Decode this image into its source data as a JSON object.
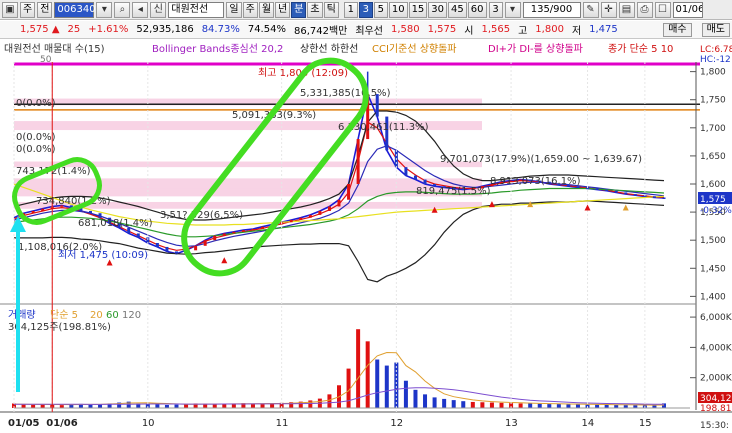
{
  "toolbar": {
    "type_label": "주",
    "market_label": "전",
    "stock_code": "006340",
    "stock_name": "대원전선",
    "periods": [
      "일",
      "주",
      "월",
      "년",
      "분",
      "초",
      "틱"
    ],
    "active_period": "분",
    "intervals": [
      "1",
      "3",
      "5",
      "10",
      "15",
      "30",
      "45",
      "60"
    ],
    "active_interval": "3",
    "interval_select": "3",
    "counter": "135/900",
    "date_field": "01/06"
  },
  "quote": {
    "price": "1,575",
    "change": "25",
    "change_pct": "+1.61%",
    "volume": "52,935,186",
    "turnover_pct": "84.73%",
    "vp": "74.54%",
    "amount": "86,742백만",
    "best_ask_label": "최우선",
    "best_ask": "1,580",
    "best_bid": "1,575",
    "open_label": "시",
    "open": "1,565",
    "high_label": "고",
    "high": "1,800",
    "low_label": "저",
    "low": "1,475",
    "buy_label": "매수",
    "sell_label": "매도"
  },
  "legend": {
    "main": "대원전선 매물대 수(15)",
    "bb": "Bollinger Bands종심선 20,2",
    "upper_lower": "상한선 하한선",
    "cci": "CCI기준선 상향돌파",
    "dmi": "DI+가 DI-를 상향돌파",
    "ma": "종가 단순 5 10",
    "lc": "LC:6.78",
    "hc": "HC:-12",
    "tag_50": "50",
    "volume_title": "거래량",
    "volume_ma": "단순 5",
    "volume_ma_periods": [
      "20",
      "60",
      "120"
    ],
    "volume_value": "304,125주(198.81%)",
    "price_tag": "1,575",
    "price_tag_pct": "-0.32%",
    "volume_tag": "304,12",
    "volume_tag_pct": "198.81",
    "time_corner": "15:30:"
  },
  "annotations": {
    "high": "최고 1,800 (12:09)",
    "low": "최저 1,475 (10:09)",
    "a1": "5,331,385(10.5%)",
    "a2": "5,091,363(9.3%)",
    "a3": "6,130,461(11.3%)",
    "a4": "9,701,073(17.9%)(1,659.00 ~ 1,639.67)",
    "a5": "0(0.0%)",
    "a6": "0(0.0%)",
    "a7": "0(0.0%)",
    "a8": "743,172(1.4%)",
    "a9": "734,840(1.2%)",
    "a10": "681,018(1.4%)",
    "a11": "3,51?,529(6.5%)",
    "a12": "1,108,016(2.0%)",
    "a13": "819,475(1.5%)",
    "a14": "8,913,073(16.1%)"
  },
  "chart_data": [
    {
      "type": "line",
      "title": "",
      "x_ticks": [
        "01/05",
        "01/06",
        "10",
        "11",
        "12",
        "13",
        "14",
        "15"
      ],
      "y_ticks": [
        1800,
        1750,
        1700,
        1650,
        1600,
        1550,
        1500,
        1450,
        1400
      ],
      "ylim": [
        1390,
        1810
      ],
      "series": [
        {
          "name": "종가",
          "color": "#1b1bd6",
          "values": [
            1540,
            1548,
            1552,
            1556,
            1560,
            1562,
            1558,
            1552,
            1548,
            1540,
            1530,
            1522,
            1512,
            1505,
            1495,
            1488,
            1480,
            1476,
            1482,
            1490,
            1500,
            1508,
            1512,
            1515,
            1518,
            1520,
            1524,
            1528,
            1532,
            1536,
            1540,
            1545,
            1552,
            1560,
            1572,
            1600,
            1680,
            1760,
            1720,
            1660,
            1630,
            1615,
            1608,
            1600,
            1596,
            1594,
            1592,
            1590,
            1592,
            1596,
            1600,
            1604,
            1606,
            1608,
            1606,
            1604,
            1600,
            1598,
            1596,
            1594,
            1592,
            1590,
            1588,
            1585,
            1582,
            1580,
            1578,
            1576,
            1575
          ]
        },
        {
          "name": "5",
          "color": "#e01010",
          "values": [
            1538,
            1544,
            1548,
            1552,
            1556,
            1558,
            1556,
            1552,
            1546,
            1540,
            1532,
            1524,
            1516,
            1508,
            1500,
            1492,
            1486,
            1482,
            1484,
            1490,
            1498,
            1504,
            1508,
            1512,
            1515,
            1518,
            1521,
            1525,
            1529,
            1533,
            1537,
            1541,
            1547,
            1554,
            1564,
            1585,
            1640,
            1710,
            1700,
            1672,
            1645,
            1628,
            1616,
            1606,
            1600,
            1597,
            1594,
            1592,
            1592,
            1595,
            1598,
            1602,
            1604,
            1606,
            1605,
            1604,
            1601,
            1599,
            1597,
            1595,
            1593,
            1591,
            1589,
            1586,
            1583,
            1581,
            1579,
            1577,
            1576
          ]
        },
        {
          "name": "10",
          "color": "#2b2bb8",
          "values": [
            1536,
            1540,
            1544,
            1548,
            1551,
            1553,
            1553,
            1551,
            1548,
            1543,
            1537,
            1530,
            1523,
            1516,
            1509,
            1502,
            1496,
            1491,
            1489,
            1490,
            1494,
            1499,
            1503,
            1507,
            1510,
            1513,
            1516,
            1520,
            1523,
            1527,
            1531,
            1535,
            1539,
            1545,
            1553,
            1566,
            1598,
            1640,
            1662,
            1668,
            1660,
            1648,
            1636,
            1624,
            1614,
            1606,
            1600,
            1596,
            1594,
            1594,
            1596,
            1598,
            1600,
            1602,
            1603,
            1603,
            1602,
            1600,
            1599,
            1597,
            1595,
            1593,
            1591,
            1589,
            1587,
            1585,
            1583,
            1581,
            1579
          ]
        },
        {
          "name": "Bollinger 중심선",
          "color": "#2a9a2a",
          "values": [
            1532,
            1534,
            1536,
            1538,
            1540,
            1541,
            1541,
            1540,
            1539,
            1537,
            1534,
            1531,
            1527,
            1523,
            1519,
            1515,
            1511,
            1508,
            1506,
            1506,
            1507,
            1508,
            1510,
            1512,
            1514,
            1516,
            1518,
            1520,
            1522,
            1524,
            1526,
            1528,
            1531,
            1534,
            1538,
            1545,
            1556,
            1570,
            1578,
            1583,
            1585,
            1586,
            1586,
            1585,
            1584,
            1583,
            1582,
            1582,
            1582,
            1583,
            1584,
            1586,
            1587,
            1589,
            1590,
            1591,
            1592,
            1592,
            1592,
            1592,
            1592,
            1591,
            1590,
            1589,
            1588,
            1587,
            1586,
            1585,
            1584
          ]
        },
        {
          "name": "상한선",
          "color": "#222222",
          "values": [
            1560,
            1564,
            1568,
            1572,
            1575,
            1577,
            1578,
            1578,
            1577,
            1575,
            1572,
            1568,
            1564,
            1560,
            1555,
            1550,
            1545,
            1540,
            1537,
            1536,
            1536,
            1537,
            1539,
            1541,
            1543,
            1545,
            1547,
            1550,
            1553,
            1556,
            1559,
            1563,
            1568,
            1574,
            1582,
            1600,
            1650,
            1710,
            1730,
            1730,
            1728,
            1722,
            1712,
            1696,
            1676,
            1652,
            1632,
            1618,
            1610,
            1606,
            1606,
            1608,
            1610,
            1612,
            1614,
            1615,
            1616,
            1616,
            1616,
            1615,
            1614,
            1613,
            1612,
            1611,
            1610,
            1609,
            1608,
            1607,
            1606
          ]
        },
        {
          "name": "하한선",
          "color": "#222222",
          "values": [
            1504,
            1504,
            1504,
            1504,
            1505,
            1505,
            1504,
            1502,
            1501,
            1499,
            1496,
            1494,
            1490,
            1486,
            1483,
            1480,
            1477,
            1476,
            1475,
            1476,
            1478,
            1479,
            1481,
            1483,
            1485,
            1487,
            1489,
            1490,
            1491,
            1492,
            1493,
            1493,
            1494,
            1494,
            1494,
            1490,
            1462,
            1430,
            1426,
            1436,
            1442,
            1450,
            1460,
            1474,
            1492,
            1514,
            1532,
            1546,
            1554,
            1560,
            1562,
            1564,
            1564,
            1566,
            1566,
            1567,
            1568,
            1568,
            1568,
            1569,
            1570,
            1569,
            1568,
            1567,
            1566,
            1565,
            1564,
            1563,
            1562
          ]
        },
        {
          "name": "CCI 기준선",
          "color": "#e8e020",
          "values": [
            1600,
            1594,
            1588,
            1582,
            1576,
            1570,
            1564,
            1559,
            1554,
            1550,
            1546,
            1542,
            1539,
            1536,
            1534,
            1532,
            1530,
            1529,
            1528,
            1527,
            1527,
            1527,
            1527,
            1528,
            1528,
            1529,
            1530,
            1531,
            1532,
            1533,
            1534,
            1535,
            1536,
            1537,
            1538,
            1540,
            1542,
            1544,
            1546,
            1548,
            1550,
            1551,
            1552,
            1553,
            1554,
            1555,
            1556,
            1557,
            1558,
            1559,
            1560,
            1561,
            1562,
            1563,
            1564,
            1565,
            1566,
            1567,
            1568,
            1569,
            1570,
            1571,
            1572,
            1573,
            1574,
            1575,
            1576,
            1577,
            1578
          ]
        }
      ]
    },
    {
      "type": "bar",
      "title": "",
      "y_ticks": [
        "6,000K",
        "4,000K",
        "2,000K"
      ],
      "ylim": [
        0,
        6600
      ],
      "series": [
        {
          "name": "거래량",
          "values": [
            300,
            240,
            220,
            260,
            200,
            190,
            230,
            270,
            210,
            250,
            300,
            360,
            420,
            280,
            260,
            230,
            200,
            220,
            260,
            300,
            280,
            240,
            260,
            300,
            320,
            280,
            260,
            300,
            340,
            380,
            420,
            500,
            620,
            900,
            1500,
            2600,
            5200,
            4400,
            3200,
            2800,
            3000,
            1800,
            1200,
            900,
            700,
            600,
            520,
            450,
            400,
            380,
            360,
            340,
            320,
            300,
            300,
            280,
            260,
            260,
            240,
            240,
            220,
            220,
            200,
            200,
            190,
            190,
            180,
            180,
            304
          ]
        },
        {
          "name": "5",
          "color": "#e0a030",
          "values": [
            260,
            250,
            240,
            235,
            230,
            228,
            225,
            230,
            235,
            240,
            262,
            292,
            330,
            338,
            340,
            320,
            300,
            270,
            250,
            250,
            256,
            260,
            262,
            268,
            278,
            286,
            290,
            294,
            300,
            310,
            340,
            380,
            432,
            522,
            742,
            1134,
            1968,
            2816,
            3440,
            3664,
            3640,
            2800,
            2380,
            1780,
            1300,
            940,
            744,
            634,
            534,
            470,
            422,
            390,
            360,
            340,
            324,
            304,
            292,
            280,
            264,
            256,
            244,
            236,
            228,
            218,
            210,
            204,
            196,
            190,
            200
          ]
        },
        {
          "name": "20",
          "color": "#7d4fd0",
          "values": [
            250,
            250,
            250,
            250,
            248,
            246,
            244,
            242,
            240,
            240,
            242,
            246,
            252,
            258,
            262,
            264,
            264,
            262,
            260,
            258,
            258,
            260,
            262,
            264,
            266,
            268,
            270,
            272,
            276,
            282,
            290,
            300,
            316,
            344,
            392,
            480,
            660,
            858,
            1010,
            1120,
            1240,
            1310,
            1340,
            1330,
            1300,
            1260,
            1200,
            1120,
            1020,
            920,
            820,
            720,
            640,
            570,
            510,
            470,
            440,
            410,
            380,
            350,
            330,
            310,
            300,
            290,
            280,
            270,
            260,
            250,
            245
          ]
        }
      ]
    }
  ]
}
